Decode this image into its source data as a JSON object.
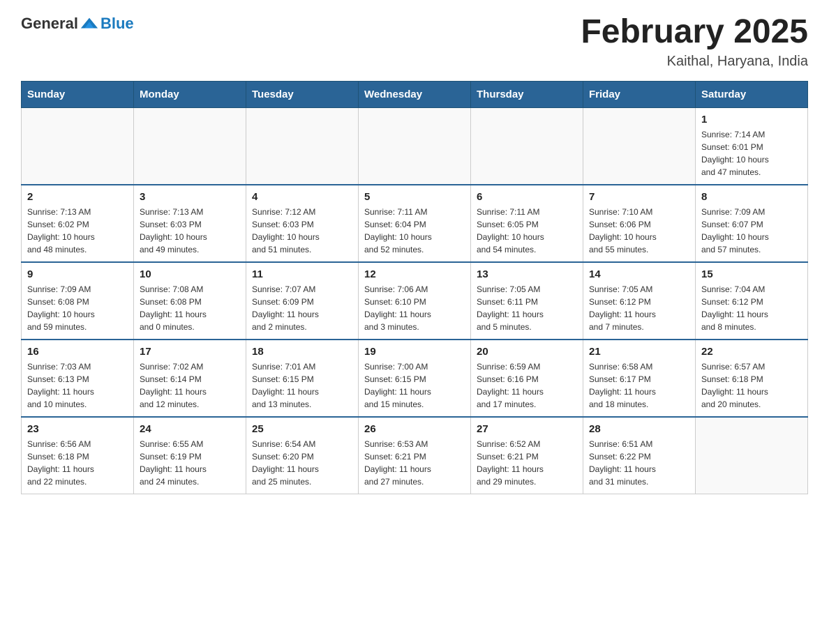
{
  "header": {
    "logo": {
      "general": "General",
      "blue": "Blue"
    },
    "title": "February 2025",
    "location": "Kaithal, Haryana, India"
  },
  "weekdays": [
    "Sunday",
    "Monday",
    "Tuesday",
    "Wednesday",
    "Thursday",
    "Friday",
    "Saturday"
  ],
  "weeks": [
    [
      {
        "day": "",
        "info": ""
      },
      {
        "day": "",
        "info": ""
      },
      {
        "day": "",
        "info": ""
      },
      {
        "day": "",
        "info": ""
      },
      {
        "day": "",
        "info": ""
      },
      {
        "day": "",
        "info": ""
      },
      {
        "day": "1",
        "info": "Sunrise: 7:14 AM\nSunset: 6:01 PM\nDaylight: 10 hours\nand 47 minutes."
      }
    ],
    [
      {
        "day": "2",
        "info": "Sunrise: 7:13 AM\nSunset: 6:02 PM\nDaylight: 10 hours\nand 48 minutes."
      },
      {
        "day": "3",
        "info": "Sunrise: 7:13 AM\nSunset: 6:03 PM\nDaylight: 10 hours\nand 49 minutes."
      },
      {
        "day": "4",
        "info": "Sunrise: 7:12 AM\nSunset: 6:03 PM\nDaylight: 10 hours\nand 51 minutes."
      },
      {
        "day": "5",
        "info": "Sunrise: 7:11 AM\nSunset: 6:04 PM\nDaylight: 10 hours\nand 52 minutes."
      },
      {
        "day": "6",
        "info": "Sunrise: 7:11 AM\nSunset: 6:05 PM\nDaylight: 10 hours\nand 54 minutes."
      },
      {
        "day": "7",
        "info": "Sunrise: 7:10 AM\nSunset: 6:06 PM\nDaylight: 10 hours\nand 55 minutes."
      },
      {
        "day": "8",
        "info": "Sunrise: 7:09 AM\nSunset: 6:07 PM\nDaylight: 10 hours\nand 57 minutes."
      }
    ],
    [
      {
        "day": "9",
        "info": "Sunrise: 7:09 AM\nSunset: 6:08 PM\nDaylight: 10 hours\nand 59 minutes."
      },
      {
        "day": "10",
        "info": "Sunrise: 7:08 AM\nSunset: 6:08 PM\nDaylight: 11 hours\nand 0 minutes."
      },
      {
        "day": "11",
        "info": "Sunrise: 7:07 AM\nSunset: 6:09 PM\nDaylight: 11 hours\nand 2 minutes."
      },
      {
        "day": "12",
        "info": "Sunrise: 7:06 AM\nSunset: 6:10 PM\nDaylight: 11 hours\nand 3 minutes."
      },
      {
        "day": "13",
        "info": "Sunrise: 7:05 AM\nSunset: 6:11 PM\nDaylight: 11 hours\nand 5 minutes."
      },
      {
        "day": "14",
        "info": "Sunrise: 7:05 AM\nSunset: 6:12 PM\nDaylight: 11 hours\nand 7 minutes."
      },
      {
        "day": "15",
        "info": "Sunrise: 7:04 AM\nSunset: 6:12 PM\nDaylight: 11 hours\nand 8 minutes."
      }
    ],
    [
      {
        "day": "16",
        "info": "Sunrise: 7:03 AM\nSunset: 6:13 PM\nDaylight: 11 hours\nand 10 minutes."
      },
      {
        "day": "17",
        "info": "Sunrise: 7:02 AM\nSunset: 6:14 PM\nDaylight: 11 hours\nand 12 minutes."
      },
      {
        "day": "18",
        "info": "Sunrise: 7:01 AM\nSunset: 6:15 PM\nDaylight: 11 hours\nand 13 minutes."
      },
      {
        "day": "19",
        "info": "Sunrise: 7:00 AM\nSunset: 6:15 PM\nDaylight: 11 hours\nand 15 minutes."
      },
      {
        "day": "20",
        "info": "Sunrise: 6:59 AM\nSunset: 6:16 PM\nDaylight: 11 hours\nand 17 minutes."
      },
      {
        "day": "21",
        "info": "Sunrise: 6:58 AM\nSunset: 6:17 PM\nDaylight: 11 hours\nand 18 minutes."
      },
      {
        "day": "22",
        "info": "Sunrise: 6:57 AM\nSunset: 6:18 PM\nDaylight: 11 hours\nand 20 minutes."
      }
    ],
    [
      {
        "day": "23",
        "info": "Sunrise: 6:56 AM\nSunset: 6:18 PM\nDaylight: 11 hours\nand 22 minutes."
      },
      {
        "day": "24",
        "info": "Sunrise: 6:55 AM\nSunset: 6:19 PM\nDaylight: 11 hours\nand 24 minutes."
      },
      {
        "day": "25",
        "info": "Sunrise: 6:54 AM\nSunset: 6:20 PM\nDaylight: 11 hours\nand 25 minutes."
      },
      {
        "day": "26",
        "info": "Sunrise: 6:53 AM\nSunset: 6:21 PM\nDaylight: 11 hours\nand 27 minutes."
      },
      {
        "day": "27",
        "info": "Sunrise: 6:52 AM\nSunset: 6:21 PM\nDaylight: 11 hours\nand 29 minutes."
      },
      {
        "day": "28",
        "info": "Sunrise: 6:51 AM\nSunset: 6:22 PM\nDaylight: 11 hours\nand 31 minutes."
      },
      {
        "day": "",
        "info": ""
      }
    ]
  ]
}
